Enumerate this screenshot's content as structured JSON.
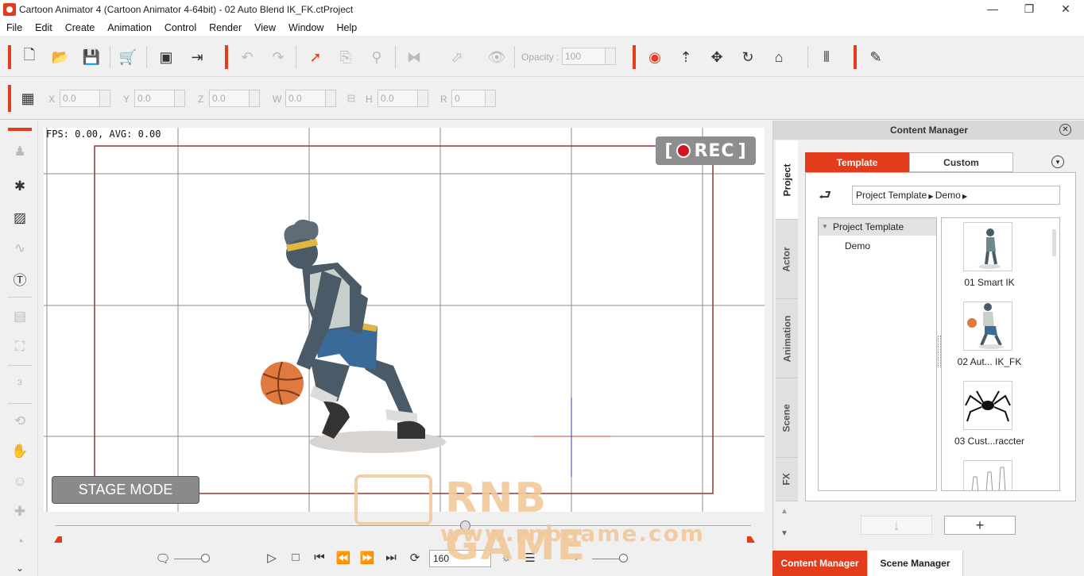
{
  "window": {
    "title": "Cartoon Animator 4  (Cartoon Animator 4-64bit) - 02 Auto Blend IK_FK.ctProject",
    "minimize": "—",
    "maximize": "❐",
    "close": "✕"
  },
  "menu": [
    "File",
    "Edit",
    "Create",
    "Animation",
    "Control",
    "Render",
    "View",
    "Window",
    "Help"
  ],
  "toolbar": {
    "opacity_label": "Opacity :",
    "opacity_value": "100"
  },
  "transform": {
    "x_label": "X",
    "x_value": "0.0",
    "y_label": "Y",
    "y_value": "0.0",
    "z_label": "Z",
    "z_value": "0.0",
    "w_label": "W",
    "w_value": "0.0",
    "h_label": "H",
    "h_value": "0.0",
    "r_label": "R",
    "r_value": "0"
  },
  "stage": {
    "fps_text": "FPS: 0.00, AVG: 0.00",
    "rec_left": "[",
    "rec_text": "REC",
    "rec_right": "]",
    "mode_label": "STAGE MODE"
  },
  "playback": {
    "frame_value": "160"
  },
  "content_manager": {
    "title": "Content Manager",
    "side_tabs": [
      "Project",
      "Actor",
      "Animation",
      "Scene",
      "FX"
    ],
    "tabs": [
      "Template",
      "Custom"
    ],
    "breadcrumb": [
      "Project Template",
      "Demo"
    ],
    "tree_root": "Project Template",
    "tree_child": "Demo",
    "items": [
      "01 Smart IK",
      "02 Aut... IK_FK",
      "03 Cust...raccter"
    ]
  },
  "bottom_tabs": [
    "Content Manager",
    "Scene Manager"
  ],
  "watermark": {
    "main": "RNB GAME",
    "sub": "www.rnbgame.com"
  },
  "colors": {
    "accent": "#e23c1c",
    "rec_dot": "#d4141c"
  }
}
